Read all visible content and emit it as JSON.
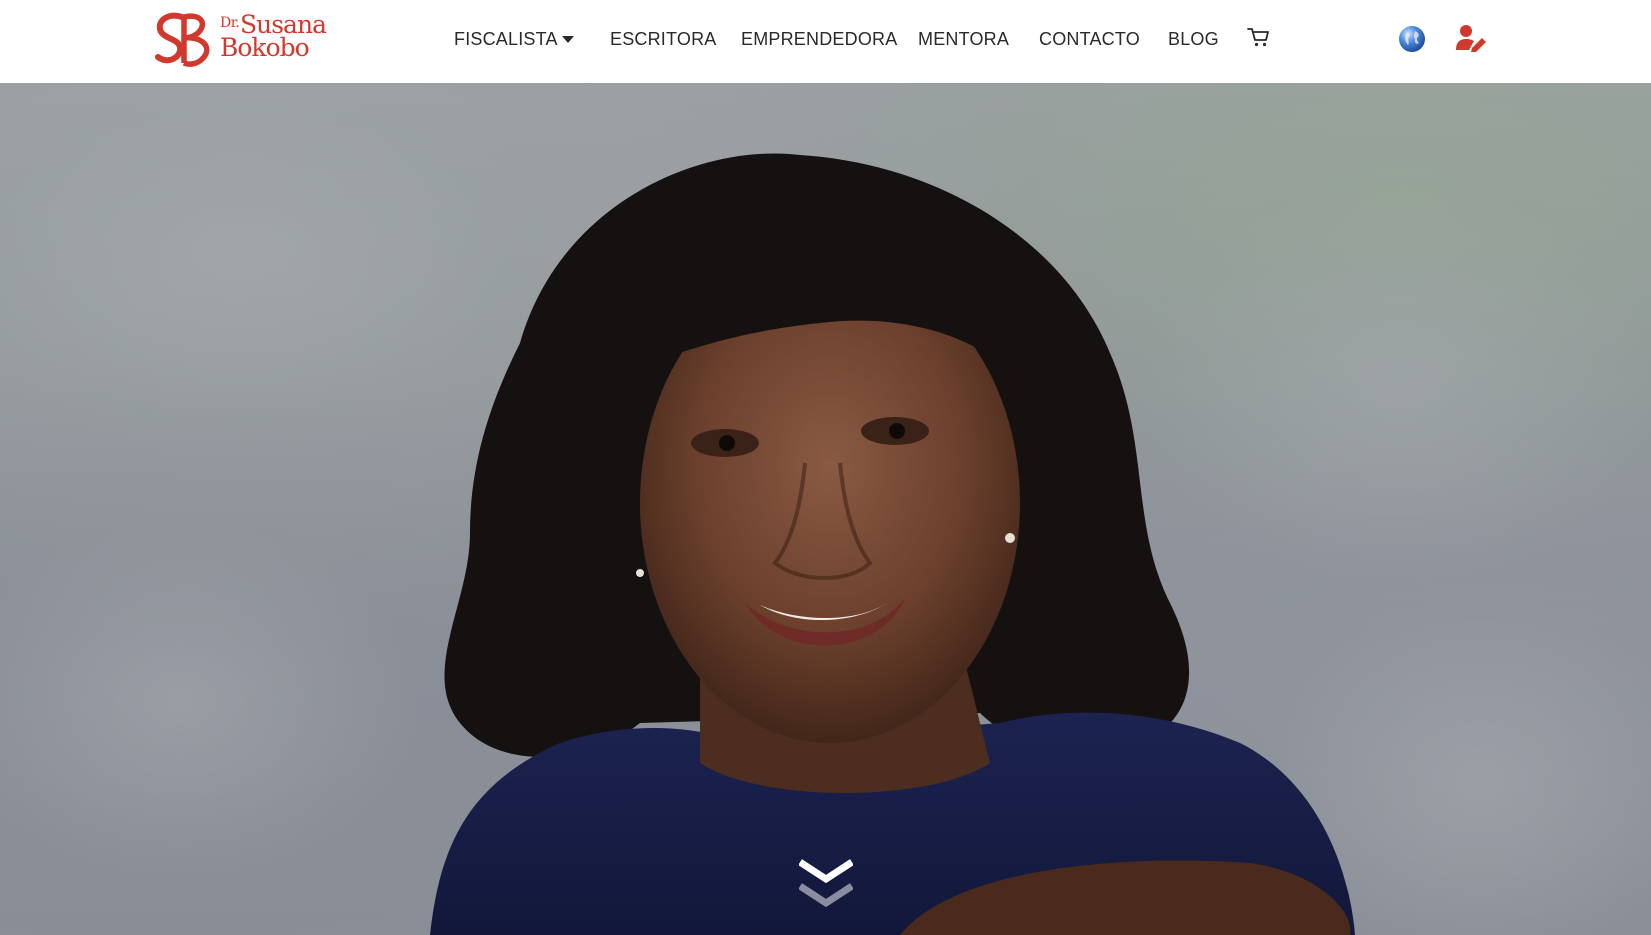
{
  "header": {
    "logo": {
      "prefix": "Dr.",
      "first_name": "Susana",
      "last_name": "Bokobo",
      "monogram": "SB",
      "brand_color": "#d1382e"
    },
    "nav": {
      "items": [
        {
          "label": "FISCALISTA",
          "has_dropdown": true
        },
        {
          "label": "ESCRITORA"
        },
        {
          "label": "EMPRENDEDORA"
        },
        {
          "label": "MENTORA"
        },
        {
          "label": "CONTACTO"
        },
        {
          "label": "BLOG"
        }
      ],
      "cart_icon": "shopping-cart-icon",
      "language_icon": "globe-icon",
      "account_icon": "user-edit-icon"
    }
  },
  "hero": {
    "image": "portrait photo of smiling woman in navy top against mottled grey backdrop",
    "scroll_icon": "double-chevron-down-icon"
  },
  "colors": {
    "accent": "#d1382e",
    "nav_text": "#2a2a2a",
    "header_bg": "#ffffff",
    "globe_blue": "#2f6fc4"
  }
}
